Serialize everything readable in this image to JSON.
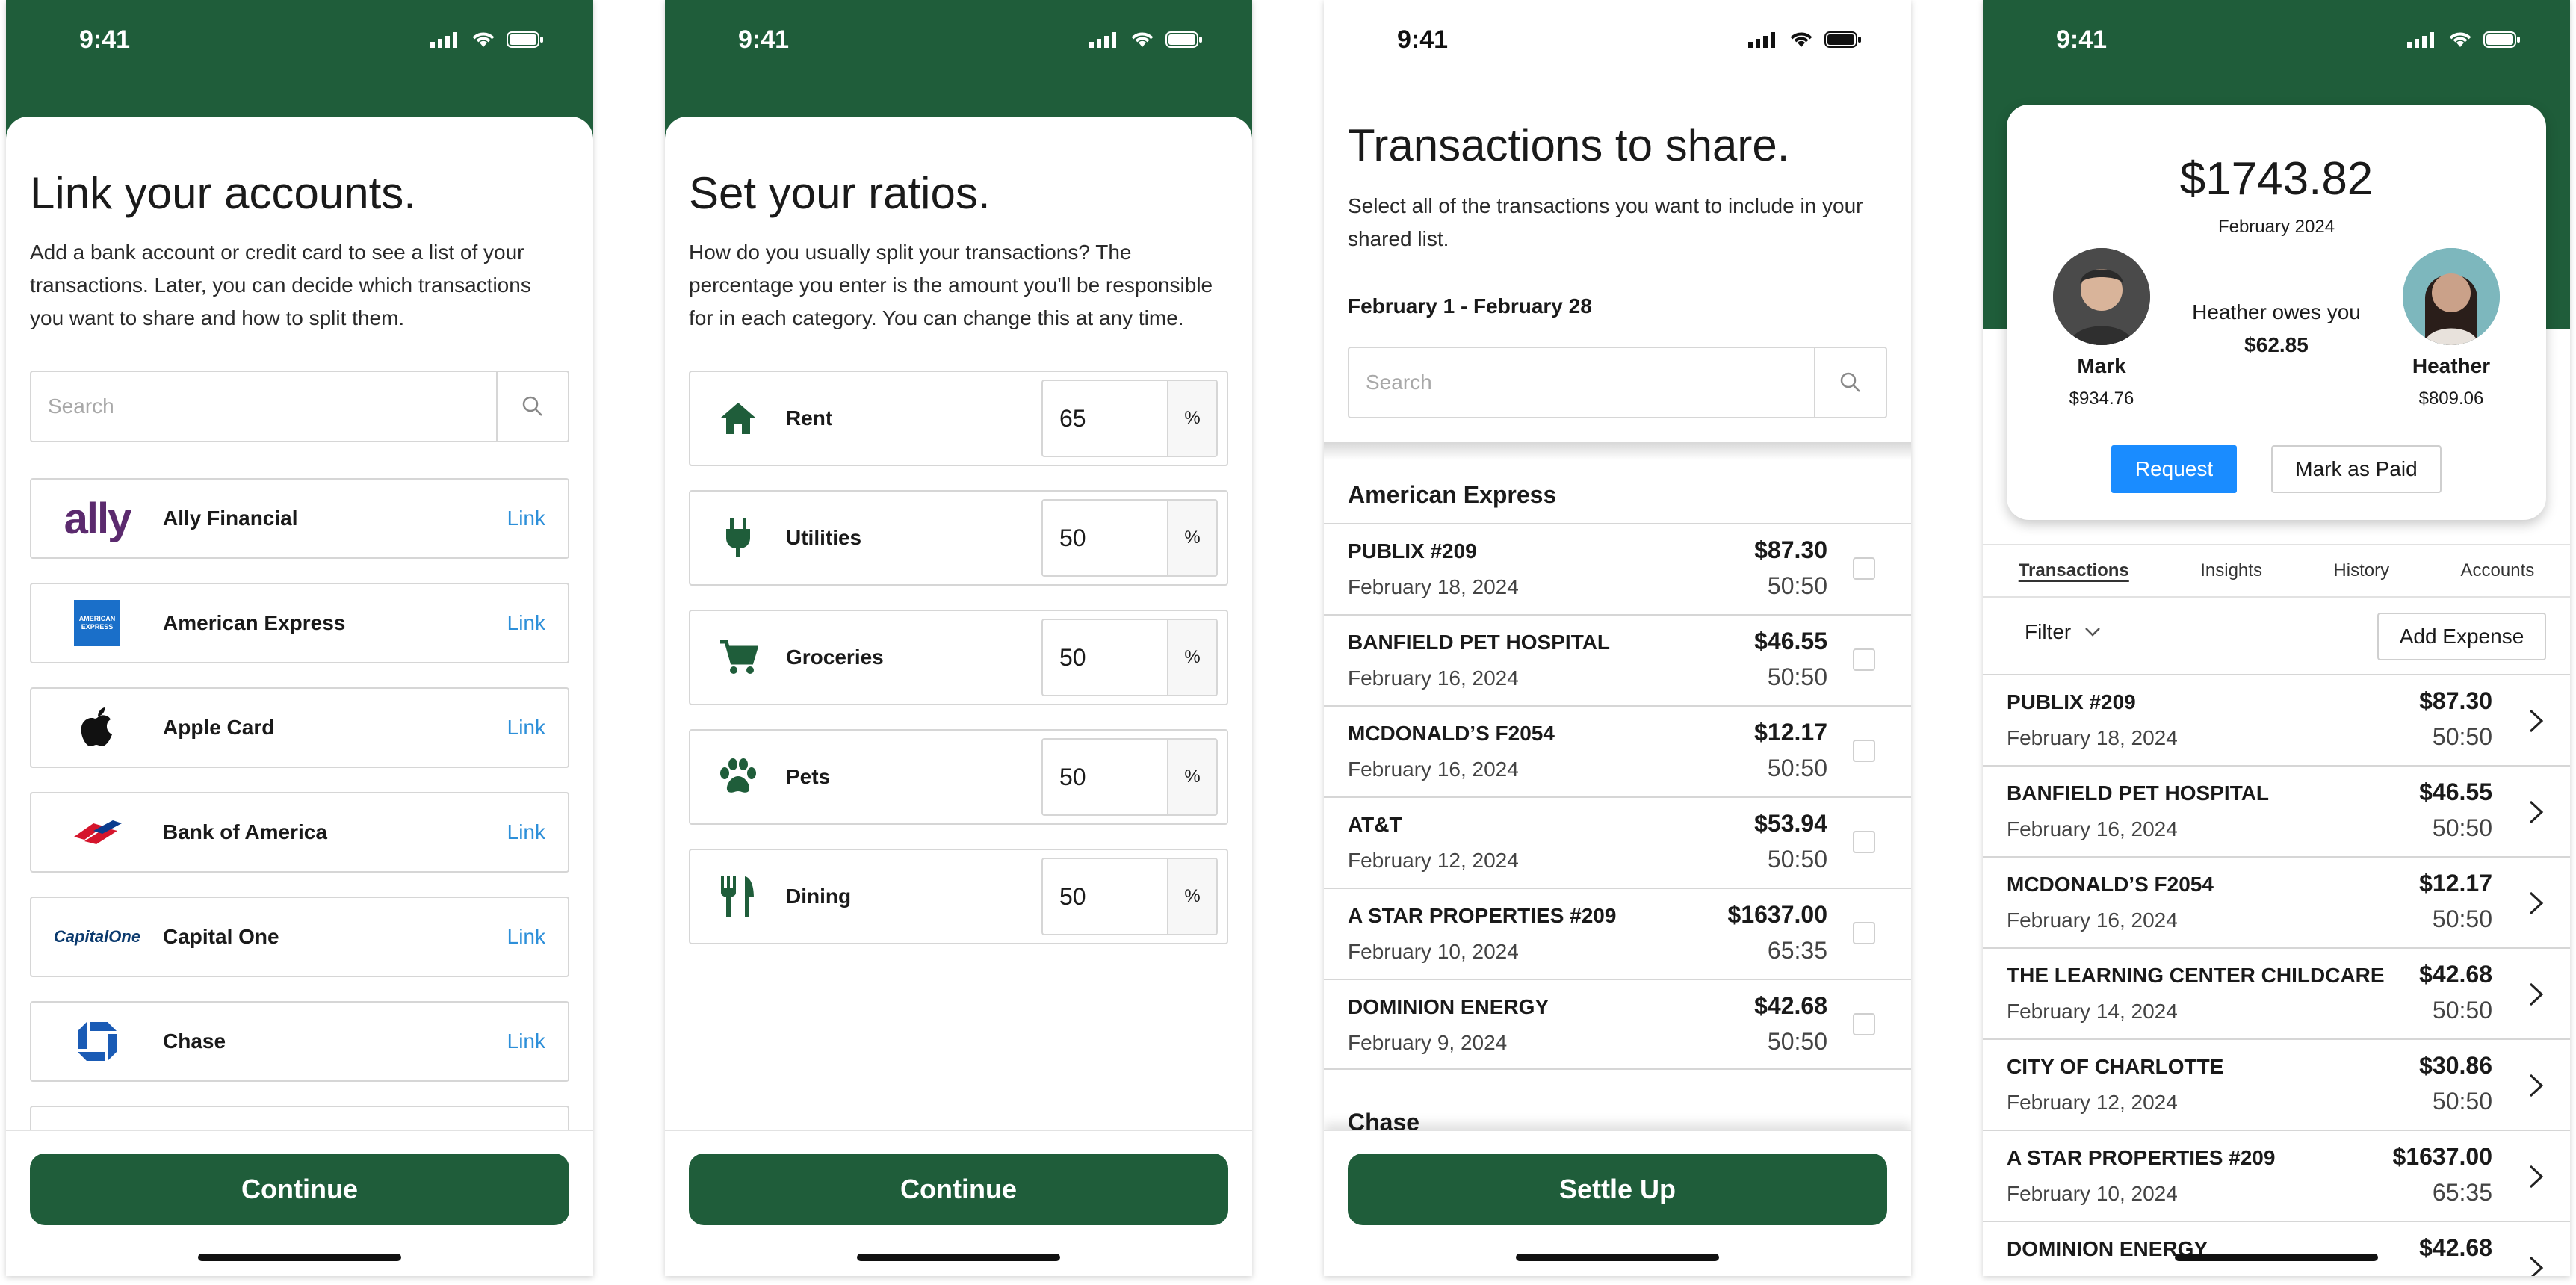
{
  "status": {
    "time": "9:41"
  },
  "screen1": {
    "title": "Link your accounts.",
    "description": "Add a bank account or credit card to see a list of your transactions. Later, you can decide which transactions you want to share and how to split them.",
    "search_placeholder": "Search",
    "banks": [
      {
        "name": "Ally Financial",
        "link": "Link",
        "logo_text": "ally"
      },
      {
        "name": "American Express",
        "link": "Link",
        "logo_text": "AMERICAN EXPRESS"
      },
      {
        "name": "Apple Card",
        "link": "Link"
      },
      {
        "name": "Bank of America",
        "link": "Link"
      },
      {
        "name": "Capital One",
        "link": "Link",
        "logo_text": "CapitalOne"
      },
      {
        "name": "Chase",
        "link": "Link"
      }
    ],
    "continue": "Continue"
  },
  "screen2": {
    "title": "Set your ratios.",
    "description": "How do you usually split your transactions? The percentage you enter is the amount you'll be responsible for in each category. You can change this at any time.",
    "categories": [
      {
        "name": "Rent",
        "value": "65",
        "unit": "%",
        "icon": "home-icon"
      },
      {
        "name": "Utilities",
        "value": "50",
        "unit": "%",
        "icon": "plug-icon"
      },
      {
        "name": "Groceries",
        "value": "50",
        "unit": "%",
        "icon": "cart-icon"
      },
      {
        "name": "Pets",
        "value": "50",
        "unit": "%",
        "icon": "paw-icon"
      },
      {
        "name": "Dining",
        "value": "50",
        "unit": "%",
        "icon": "fork-knife-icon"
      }
    ],
    "continue": "Continue"
  },
  "screen3": {
    "title": "Transactions to share.",
    "description": "Select all of the transactions you want to include in your shared list.",
    "date_range": "February 1 - February 28",
    "search_placeholder": "Search",
    "group1": "American Express",
    "group2": "Chase",
    "transactions": [
      {
        "name": "PUBLIX #209",
        "date": "February 18, 2024",
        "amount": "$87.30",
        "ratio": "50:50"
      },
      {
        "name": "BANFIELD PET HOSPITAL",
        "date": "February 16, 2024",
        "amount": "$46.55",
        "ratio": "50:50"
      },
      {
        "name": "MCDONALD’S F2054",
        "date": "February 16, 2024",
        "amount": "$12.17",
        "ratio": "50:50"
      },
      {
        "name": "AT&T",
        "date": "February 12, 2024",
        "amount": "$53.94",
        "ratio": "50:50"
      },
      {
        "name": "A STAR PROPERTIES #209",
        "date": "February 10, 2024",
        "amount": "$1637.00",
        "ratio": "65:35"
      },
      {
        "name": "DOMINION ENERGY",
        "date": "February 9, 2024",
        "amount": "$42.68",
        "ratio": "50:50"
      }
    ],
    "settle_up": "Settle Up"
  },
  "screen4": {
    "total": "$1743.82",
    "month": "February 2024",
    "person1": {
      "name": "Mark",
      "amount": "$934.76"
    },
    "person2": {
      "name": "Heather",
      "amount": "$809.06"
    },
    "owes_text": "Heather owes you",
    "owes_amount": "$62.85",
    "request": "Request",
    "mark_paid": "Mark as Paid",
    "tabs": [
      "Transactions",
      "Insights",
      "History",
      "Accounts"
    ],
    "filter": "Filter",
    "add_expense": "Add Expense",
    "transactions": [
      {
        "name": "PUBLIX #209",
        "date": "February 18, 2024",
        "amount": "$87.30",
        "ratio": "50:50"
      },
      {
        "name": "BANFIELD PET HOSPITAL",
        "date": "February 16, 2024",
        "amount": "$46.55",
        "ratio": "50:50"
      },
      {
        "name": "MCDONALD’S F2054",
        "date": "February 16, 2024",
        "amount": "$12.17",
        "ratio": "50:50"
      },
      {
        "name": "THE LEARNING CENTER CHILDCARE",
        "date": "February 14, 2024",
        "amount": "$42.68",
        "ratio": "50:50"
      },
      {
        "name": "CITY OF CHARLOTTE",
        "date": "February 12, 2024",
        "amount": "$30.86",
        "ratio": "50:50"
      },
      {
        "name": "A STAR PROPERTIES #209",
        "date": "February 10, 2024",
        "amount": "$1637.00",
        "ratio": "65:35"
      },
      {
        "name": "DOMINION ENERGY",
        "date": "",
        "amount": "$42.68",
        "ratio": ""
      }
    ]
  },
  "colors": {
    "brand_green": "#1f5d3a",
    "link_blue": "#2d8fd9",
    "request_blue": "#1a8cff"
  }
}
